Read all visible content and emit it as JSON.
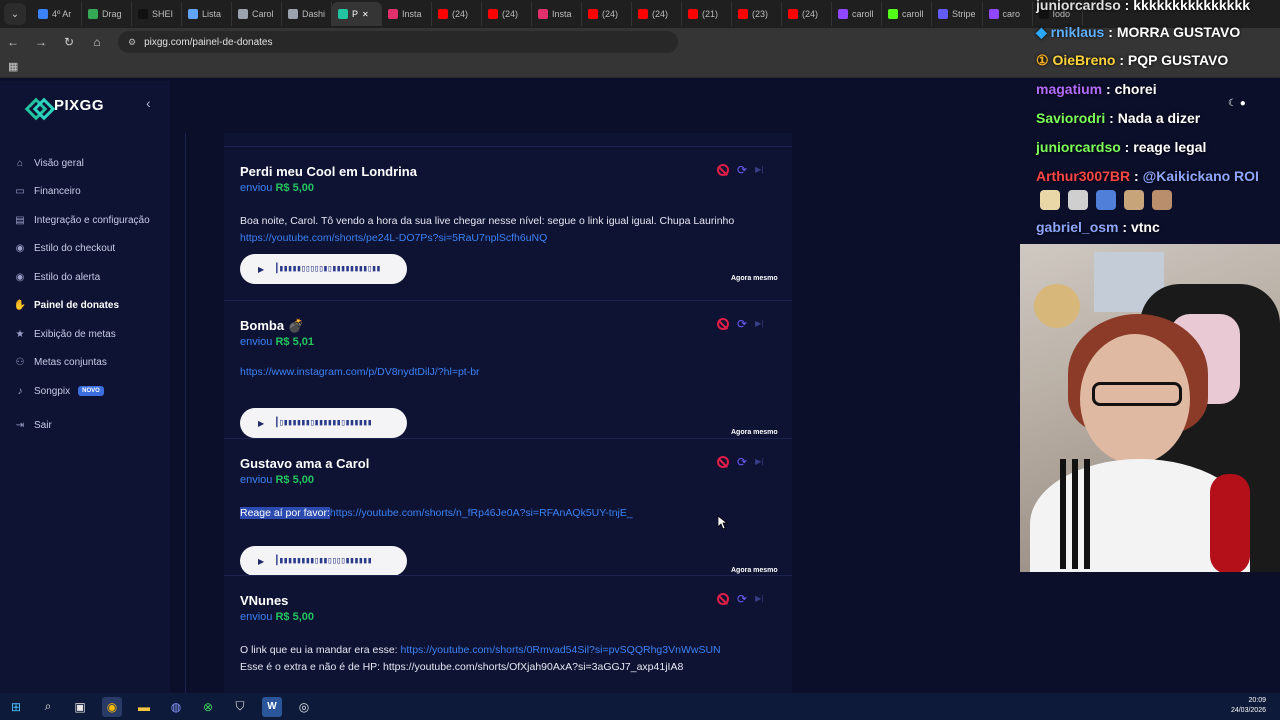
{
  "browser": {
    "tabs": [
      {
        "label": "4º Ar",
        "color": "#3b82f6"
      },
      {
        "label": "Drag",
        "color": "#34a853"
      },
      {
        "label": "SHEI",
        "color": "#111111"
      },
      {
        "label": "Lista",
        "color": "#60a5fa"
      },
      {
        "label": "Carol",
        "color": "#9ca3af"
      },
      {
        "label": "Dashi",
        "color": "#9ca3af"
      },
      {
        "label": "P",
        "color": "#22c3a0"
      },
      {
        "label": "Insta",
        "color": "#e1306c"
      },
      {
        "label": "(24)",
        "color": "#ff0000"
      },
      {
        "label": "(24)",
        "color": "#ff0000"
      },
      {
        "label": "Insta",
        "color": "#e1306c"
      },
      {
        "label": "(24)",
        "color": "#ff0000"
      },
      {
        "label": "(24)",
        "color": "#ff0000"
      },
      {
        "label": "(21)",
        "color": "#ff0000"
      },
      {
        "label": "(23)",
        "color": "#ff0000"
      },
      {
        "label": "(24)",
        "color": "#ff0000"
      },
      {
        "label": "caroll",
        "color": "#9146ff"
      },
      {
        "label": "caroll",
        "color": "#53fc18"
      },
      {
        "label": "Stripe",
        "color": "#635bff"
      },
      {
        "label": "caro",
        "color": "#9146ff"
      },
      {
        "label": "Iodo",
        "color": "#111111"
      }
    ],
    "url": "pixgg.com/painel-de-donates"
  },
  "sidebar": {
    "logo": "PIXGG",
    "items": [
      {
        "label": "Visão geral",
        "icon": "home-icon",
        "glyph": "⌂"
      },
      {
        "label": "Financeiro",
        "icon": "wallet-icon",
        "glyph": "▭"
      },
      {
        "label": "Integração e configuração",
        "icon": "settings-icon",
        "glyph": "▤"
      },
      {
        "label": "Estilo do checkout",
        "icon": "palette-icon",
        "glyph": "◉"
      },
      {
        "label": "Estilo do alerta",
        "icon": "palette-icon",
        "glyph": "◉"
      },
      {
        "label": "Painel de donates",
        "icon": "hand-coin-icon",
        "glyph": "✋"
      },
      {
        "label": "Exibição de metas",
        "icon": "star-icon",
        "glyph": "★"
      },
      {
        "label": "Metas conjuntas",
        "icon": "group-icon",
        "glyph": "⚇"
      },
      {
        "label": "Songpix",
        "icon": "music-icon",
        "glyph": "♪",
        "badge": "NOVO"
      },
      {
        "label": "Sair",
        "icon": "logout-icon",
        "glyph": "⇥"
      }
    ],
    "active_index": 5
  },
  "donations": [
    {
      "name": "Perdi meu Cool em Londrina",
      "sent_label": "enviou",
      "amount": "R$ 5,00",
      "message_parts": [
        {
          "text": "Boa noite, Carol. Tô vendo a hora da sua live chegar nesse nível: segue o link igual igual. Chupa Laurinho",
          "style": "plain"
        },
        {
          "text": "https://youtube.com/shorts/pe24L-DO7Ps?si=5RaU7nplScfh6uNQ",
          "style": "link",
          "newline": true
        }
      ],
      "wave": "┃▮▮▮▮▮▯▯▯▯▯▮▯▮▮▮▮▮▮▮▮▯▮▮",
      "time": "Agora mesmo"
    },
    {
      "name": "Bomba 💣",
      "sent_label": "enviou",
      "amount": "R$ 5,01",
      "message_parts": [
        {
          "text": "https://www.instagram.com/p/DV8nydtDilJ/?hl=pt-br",
          "style": "link"
        }
      ],
      "wave": "┃▯▮▮▮▮▮▮▯▮▮▮▮▮▮▯▮▮▮▮▮▮",
      "time": "Agora mesmo"
    },
    {
      "name": "Gustavo ama a Carol",
      "sent_label": "enviou",
      "amount": "R$ 5,00",
      "message_parts": [
        {
          "text": "Reage aí por favor:",
          "style": "highlight"
        },
        {
          "text": "https://youtube.com/shorts/n_fRp46Je0A?si=RFAnAQk5UY-tnjE_",
          "style": "link"
        }
      ],
      "wave": "┃▮▮▮▮▮▮▮▮▯▮▮▯▯▯▯▮▮▮▮▮▮",
      "time": "Agora mesmo"
    },
    {
      "name": "VNunes",
      "sent_label": "enviou",
      "amount": "R$ 5,00",
      "message_parts": [
        {
          "text": "O link que eu ia mandar era esse: ",
          "style": "plain"
        },
        {
          "text": "https://youtube.com/shorts/0Rmvad54Sil?si=pvSQQRhg3VnWwSUN",
          "style": "link"
        },
        {
          "text": "Esse é o extra e não é de HP: https://youtube.com/shorts/OfXjah90AxA?si=3aGGJ7_axp41jIA8",
          "style": "plain",
          "newline": true
        }
      ],
      "wave": "",
      "time": ""
    }
  ],
  "chat": [
    {
      "user": "juniorcardso",
      "text": "kkkkkkkkkkkkkkk",
      "color": "#dedede",
      "badge": ""
    },
    {
      "user": "rniklaus",
      "text": "MORRA GUSTAVO",
      "color": "#5fb0ff",
      "badge": "prime"
    },
    {
      "user": "OieBreno",
      "text": "PQP GUSTAVO",
      "color": "#ffd43b",
      "badge": "1"
    },
    {
      "user": "magatium",
      "text": "chorei",
      "color": "#b36bff",
      "badge": ""
    },
    {
      "user": "Saviorodri",
      "text": "Nada a dizer",
      "color": "#7dff5a",
      "badge": ""
    },
    {
      "user": "juniorcardso",
      "text": "reage legal",
      "color": "#7dff5a",
      "badge": ""
    },
    {
      "user": "Arthur3007BR",
      "text": "@Kaikickano ROI",
      "color": "#ff4545",
      "badge": "",
      "mention_color": "#8ea6ff"
    },
    {
      "user": "gabriel_osm",
      "text": "vtnc",
      "color": "#8ea6ff",
      "badge": ""
    }
  ],
  "taskbar": {
    "time": "20:09",
    "date": "24/03/2026"
  }
}
